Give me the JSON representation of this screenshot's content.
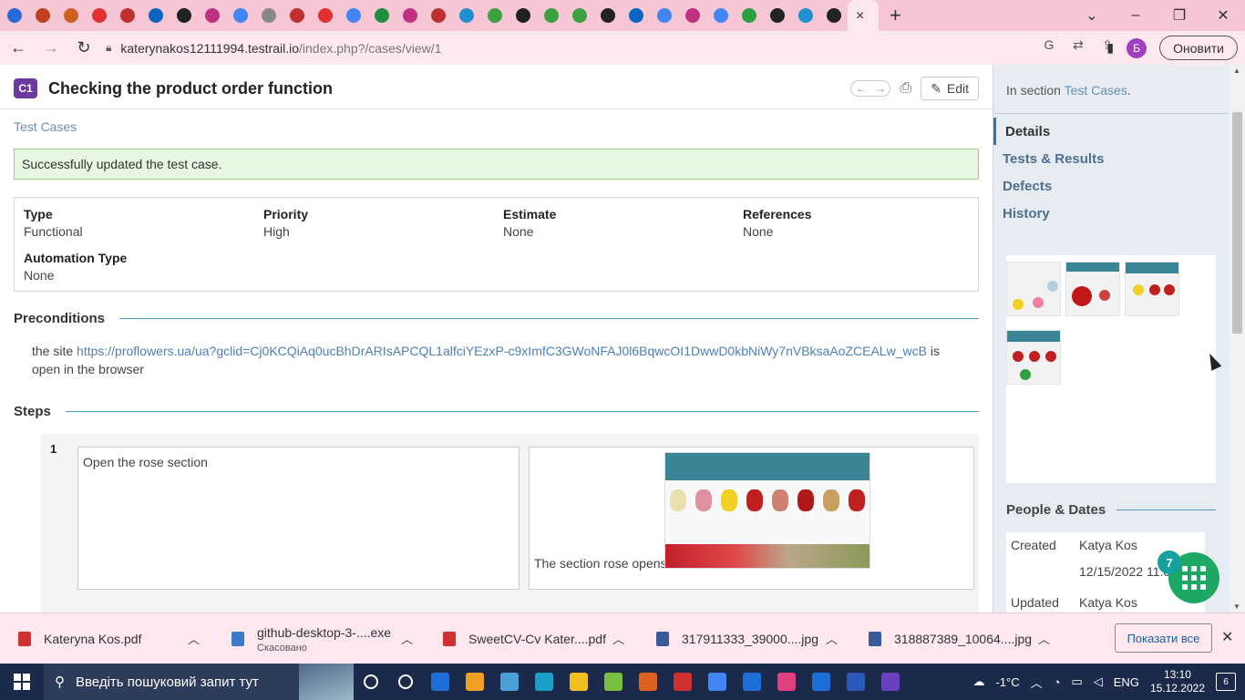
{
  "browser": {
    "active_tab_close": "×",
    "url_domain": "katerynakos12111994.testrail.io",
    "url_path": "/index.php?/cases/view/1",
    "profile_initial": "Б",
    "update_label": "Оновити",
    "tab_colors": [
      "#2a6ad8",
      "#c04020",
      "#d06020",
      "#e03030",
      "#c03030",
      "#0a66c2",
      "#222222",
      "#c03080",
      "#4285f4",
      "#888888",
      "#c03030",
      "#e03030",
      "#4285f4",
      "#1f8f3f",
      "#c03080",
      "#c03030",
      "#1e90d0",
      "#3aa040",
      "#222222",
      "#3aa040",
      "#3aa040",
      "#222222",
      "#0a66c2",
      "#4285f4",
      "#c03080",
      "#4285f4",
      "#2aa040",
      "#222222",
      "#1e90d0",
      "#222222"
    ]
  },
  "page": {
    "case_badge": "C1",
    "case_title": "Checking the product order function",
    "edit_label": "Edit",
    "breadcrumb": "Test Cases",
    "success_message": "Successfully updated the test case.",
    "fields": [
      {
        "label": "Type",
        "value": "Functional"
      },
      {
        "label": "Priority",
        "value": "High"
      },
      {
        "label": "Estimate",
        "value": "None"
      },
      {
        "label": "References",
        "value": "None"
      },
      {
        "label": "Automation Type",
        "value": "None"
      }
    ],
    "preconditions_heading": "Preconditions",
    "precondition_prefix": "the site ",
    "precondition_link": "https://proflowers.ua/ua?gclid=Cj0KCQiAq0ucBhDrARIsAPCQL1alfciYEzxP-c9xImfC3GWoNFAJ0l6BqwcOI1DwwD0kbNiWy7nVBksaAoZCEALw_wcB",
    "precondition_suffix": " is open in the browser",
    "steps_heading": "Steps",
    "steps": [
      {
        "number": "1",
        "action": "Open the rose section",
        "expected": "The section rose opens"
      }
    ]
  },
  "sidebar": {
    "in_section_prefix": "In section ",
    "in_section_link": "Test Cases",
    "in_section_suffix": ".",
    "nav": [
      "Details",
      "Tests & Results",
      "Defects",
      "History"
    ],
    "people_heading": "People & Dates",
    "created_label": "Created",
    "created_by": "Katya Kos",
    "created_date": "12/15/2022 11:09",
    "updated_label": "Updated",
    "updated_by": "Katya Kos",
    "chat_count": "7"
  },
  "downloads": {
    "items": [
      {
        "name": "Kateryna Kos.pdf",
        "sub": "",
        "color": "#d03030"
      },
      {
        "name": "github-desktop-3-....exe",
        "sub": "Скасовано",
        "color": "#3a7ac8"
      },
      {
        "name": "SweetCV-Cv Kater....pdf",
        "sub": "",
        "color": "#d03030"
      },
      {
        "name": "317911333_39000....jpg",
        "sub": "",
        "color": "#3a5a9a"
      },
      {
        "name": "318887389_10064....jpg",
        "sub": "",
        "color": "#3a5a9a"
      }
    ],
    "show_all": "Показати все"
  },
  "taskbar": {
    "search_placeholder": "Введіть пошуковий запит тут",
    "temperature": "-1°C",
    "language": "ENG",
    "time": "13:10",
    "date": "15.12.2022",
    "notification_count": "6",
    "app_colors": [
      "#ffffff",
      "#ffffff",
      "#1e6ed8",
      "#f0a020",
      "#4a9fd8",
      "#1aa0c8",
      "#f0c020",
      "#7ac040",
      "#e06020",
      "#d03030",
      "#4285f4",
      "#1e6ed8",
      "#e04080",
      "#1e6ed8",
      "#2a5ab8",
      "#6a40c0"
    ]
  }
}
